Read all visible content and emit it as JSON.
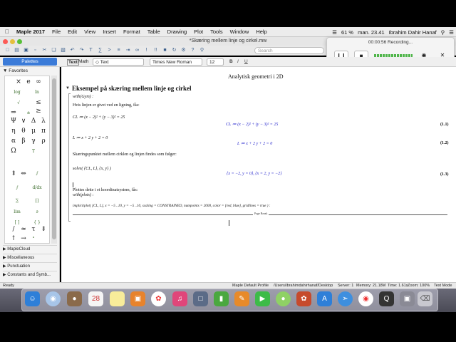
{
  "menubar": {
    "items": [
      "Maple 2017",
      "File",
      "Edit",
      "View",
      "Insert",
      "Format",
      "Table",
      "Drawing",
      "Plot",
      "Tools",
      "Window",
      "Help"
    ],
    "battery": "61 %",
    "clock": "man. 23.41",
    "user": "Ibrahim Dahir Hanaf"
  },
  "window": {
    "title": "*Skæring mellem linje og cirkel.mw"
  },
  "toolbar": {
    "search_placeholder": "Search"
  },
  "recording": {
    "title": "00:00:56 Recording..."
  },
  "formatbar": {
    "palettes_label": "Palettes",
    "mode_text": "Text",
    "mode_math": "Math",
    "style": "Text",
    "font": "Times New Roman",
    "size": "12"
  },
  "palettes": {
    "favorites_label": "Favorites",
    "sections": [
      "MapleCloud",
      "Miscellaneous",
      "Punctuation",
      "Constants and Symb..."
    ]
  },
  "document": {
    "heading": "Analytisk geometri i 2D",
    "section_title": "Eksempel på skæring mellem linje og cirkel",
    "cmd1": "with(Gym) :",
    "para1": "Hvis linjen er givet ved en ligning, fås:",
    "input1": "CL ≔ (x − 2)² + (y − 3)² = 25",
    "output1": "CL ≔ (x − 2)² + (y − 3)² = 25",
    "label1": "(1.1)",
    "input2": "L ≔ x + 2 y + 2 = 0",
    "output2": "L ≔ x + 2 y + 2 = 0",
    "label2": "(1.2)",
    "para2": "Skæringspunktet mellem cirklen og linjen findes som følger:",
    "input3": "solve( {CL, L}, {x, y} )",
    "output3": "{x = −2, y = 0}, {x = 2, y = −2}",
    "label3": "(1.3)",
    "para3": "Plottes dette i et koordinatsystem, fås:",
    "cmd2": "with(plots) :",
    "input4": "implicitplot( [CL, L], x = −5 ..10, y = −5 ..10, scaling = CONSTRAINED, numpoints = 2000, color = [red, blue], gridlines = true ) :",
    "page_break": "Page Break"
  },
  "statusbar": {
    "ready": "Ready",
    "profile": "Maple Default Profile",
    "path": "/Users/ibrahimdahirhanaf/Desktop",
    "server": "Server: 1",
    "memory": "Memory: 21.18M",
    "time": "Time: 1.61s",
    "zoom": "Zoom: 100%",
    "mode": "Text Mode"
  },
  "dock": {
    "calendar_day": "28"
  },
  "colors": {
    "accent": "#3b7bd8",
    "output_blue": "#2222cc"
  }
}
